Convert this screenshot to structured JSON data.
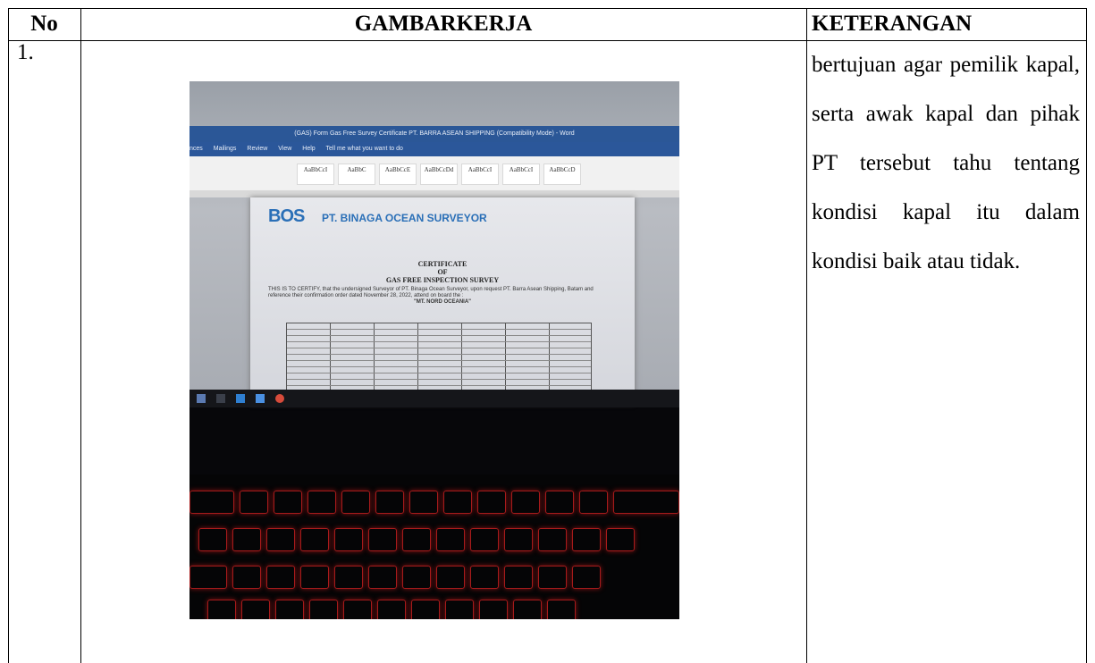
{
  "table": {
    "headers": {
      "no": "No",
      "gambar": "GAMBARKERJA",
      "keterangan": "KETERANGAN"
    },
    "row": {
      "no": "1.",
      "keterangan": "bertujuan agar pemilik kapal, serta awak kapal dan pihak PT tersebut tahu tentang kondisi kapal itu dalam kondisi baik atau tidak."
    }
  },
  "photo": {
    "window_title": "(GAS) Form Gas Free Survey Certificate PT. BARRA ASEAN SHIPPING (Compatibility Mode) - Word",
    "menu": [
      "nces",
      "Mailings",
      "Review",
      "View",
      "Help",
      "Tell me what you want to do"
    ],
    "logo": "BOS",
    "company": "PT. BINAGA OCEAN SURVEYOR",
    "certificate_title": "CERTIFICATE",
    "certificate_of": "OF",
    "certificate_subtitle": "GAS FREE INSPECTION SURVEY",
    "vessel": "\"MT. NORD OCEANIA\"",
    "certify_text": "THIS IS TO CERTIFY, that the undersigned Surveyor of PT. Binaga Ocean Surveyor, upon request PT. Barra Asean Shipping, Batam and reference their confirmation order dated November 28, 2022, attend on board the :"
  }
}
